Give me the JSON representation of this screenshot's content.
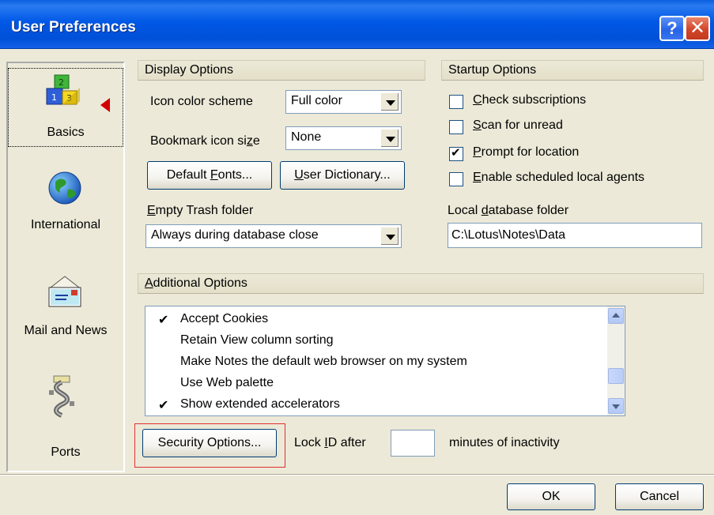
{
  "window": {
    "title": "User Preferences",
    "help_glyph": "?",
    "close_glyph": "✕"
  },
  "sidebar": {
    "items": [
      {
        "label": "Basics",
        "icon": "blocks-icon",
        "selected": true
      },
      {
        "label": "International",
        "icon": "globe-icon"
      },
      {
        "label": "Mail and News",
        "icon": "mail-envelope-icon"
      },
      {
        "label": "Ports",
        "icon": "ports-icon"
      }
    ]
  },
  "display_options": {
    "header": "Display Options",
    "icon_color_scheme": {
      "label_pre": "Icon color scheme",
      "value": "Full color"
    },
    "bookmark_icon_size": {
      "label_pre": "Bookmark icon si",
      "label_key": "z",
      "label_post": "e",
      "value": "None"
    },
    "default_fonts_button": {
      "pre": "Default ",
      "key": "F",
      "post": "onts..."
    },
    "user_dictionary_button": {
      "pre": "",
      "key": "U",
      "post": "ser Dictionary..."
    },
    "empty_trash": {
      "label_key": "E",
      "label_post": "mpty Trash folder",
      "value": "Always during database close"
    }
  },
  "startup_options": {
    "header": "Startup Options",
    "items": [
      {
        "key": "C",
        "post": "heck subscriptions",
        "checked": false
      },
      {
        "key": "S",
        "post": "can for unread",
        "checked": false
      },
      {
        "key": "P",
        "post": "rompt for location",
        "checked": true
      },
      {
        "key": "E",
        "post": "nable scheduled local agents",
        "checked": false
      }
    ],
    "local_db": {
      "label_pre": "Local ",
      "label_key": "d",
      "label_post": "atabase folder",
      "value": "C:\\Lotus\\Notes\\Data"
    }
  },
  "additional_options": {
    "header_key": "A",
    "header_post": "dditional Options",
    "items": [
      {
        "label": "Accept Cookies",
        "checked": true
      },
      {
        "label": "Retain View column sorting",
        "checked": false
      },
      {
        "label": "Make Notes the default web browser on my system",
        "checked": false
      },
      {
        "label": "Use Web palette",
        "checked": false
      },
      {
        "label": "Show extended accelerators",
        "checked": true
      }
    ],
    "check_glyph": "✔"
  },
  "security": {
    "button_label": "Security Options...",
    "lock_pre": "Lock ",
    "lock_key": "I",
    "lock_post": "D after",
    "lock_value": "",
    "minutes_label": "minutes of inactivity"
  },
  "footer": {
    "ok_label": "OK",
    "cancel_label": "Cancel"
  },
  "colors": {
    "titlebar": "#0058e6",
    "highlight": "#e03030",
    "dialog_bg": "#ece9d8"
  }
}
